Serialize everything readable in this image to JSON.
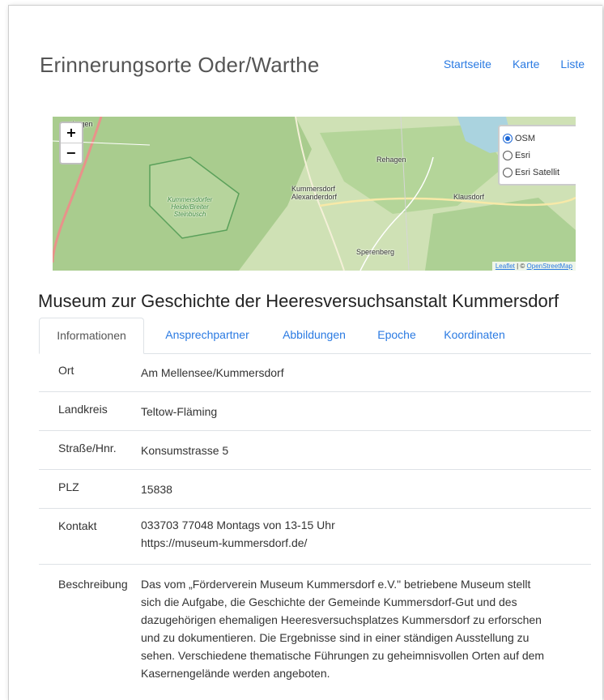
{
  "header": {
    "title": "Erinnerungsorte Oder/Warthe",
    "nav": [
      "Startseite",
      "Karte",
      "Liste"
    ]
  },
  "map": {
    "zoom_in": "+",
    "zoom_out": "−",
    "layers": [
      {
        "label": "OSM",
        "selected": true
      },
      {
        "label": "Esri",
        "selected": false
      },
      {
        "label": "Esri Satellit",
        "selected": false
      }
    ],
    "attribution_leaflet": "Leaflet",
    "attribution_sep": " | © ",
    "attribution_osm": "OpenStreetMap",
    "places": {
      "shagen": "shagen",
      "rehagen": "Rehagen",
      "kummersdorf": "Kummersdorf",
      "alexanderdorf": "Alexanderdorf",
      "klausdorf": "Klausdorf",
      "sperenberg": "Sperenberg",
      "heide_1": "Kummersdorfer",
      "heide_2": "Heide/Breiter",
      "heide_3": "Steinbusch"
    }
  },
  "place": {
    "title": "Museum zur Geschichte der Heeresversuchsanstalt Kummersdorf"
  },
  "tabs": [
    "Informationen",
    "Ansprechpartner",
    "Abbildungen",
    "Epoche",
    "Koordinaten"
  ],
  "info": {
    "ort_label": "Ort",
    "ort_value": "Am Mellensee/Kummersdorf",
    "landkreis_label": "Landkreis",
    "landkreis_value": "Teltow-Fläming",
    "strasse_label": "Straße/Hnr.",
    "strasse_value": "Konsumstrasse 5",
    "plz_label": "PLZ",
    "plz_value": "15838",
    "kontakt_label": "Kontakt",
    "kontakt_line1": "033703 77048 Montags von 13-15 Uhr",
    "kontakt_line2": "https://museum-kummersdorf.de/",
    "beschreibung_label": "Beschreibung",
    "beschreibung_lines": [
      "Das vom „Förderverein Museum Kummersdorf e.V.\" betriebene Museum stellt",
      "sich die Aufgabe, die Geschichte der Gemeinde Kummersdorf-Gut und des",
      "dazugehörigen ehemaligen Heeresversuchsplatzes Kummersdorf zu erforschen",
      "und zu dokumentieren. Die Ergebnisse sind in einer ständigen Ausstellung zu",
      "sehen. Verschiedene thematische Führungen zu geheimnisvollen Orten auf dem",
      "Kasernengelände werden angeboten."
    ]
  },
  "colors": {
    "link": "#2a7ae2",
    "forest": "#a9cc8e",
    "meadow": "#cfe1b5",
    "water": "#aad3df"
  }
}
